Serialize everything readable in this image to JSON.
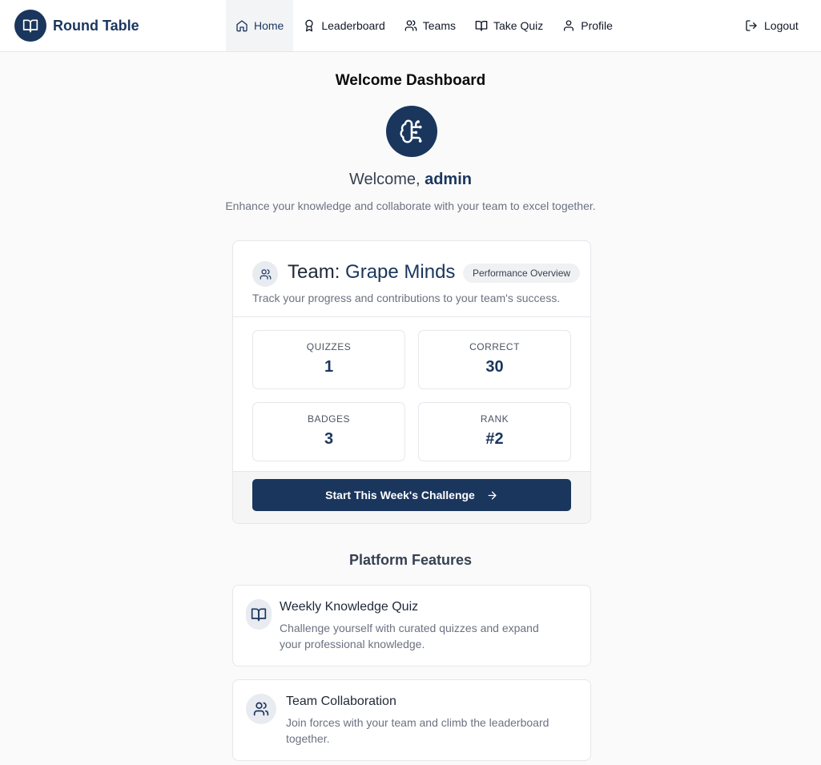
{
  "brand": {
    "name": "Round Table"
  },
  "nav": {
    "items": [
      {
        "label": "Home"
      },
      {
        "label": "Leaderboard"
      },
      {
        "label": "Teams"
      },
      {
        "label": "Take Quiz"
      },
      {
        "label": "Profile"
      }
    ],
    "active": "Home",
    "logout": "Logout"
  },
  "page": {
    "title": "Welcome Dashboard",
    "welcome_prefix": "Welcome,",
    "username": "admin",
    "tagline": "Enhance your knowledge and collaborate with your team to excel together."
  },
  "team": {
    "title_prefix": "Team:",
    "name": "Grape Minds",
    "badge": "Performance Overview",
    "subtitle": "Track your progress and contributions to your team's success.",
    "stats": [
      {
        "label": "QUIZZES",
        "value": "1"
      },
      {
        "label": "CORRECT",
        "value": "30"
      },
      {
        "label": "BADGES",
        "value": "3"
      },
      {
        "label": "RANK",
        "value": "#2"
      }
    ],
    "cta": "Start This Week's Challenge"
  },
  "features": {
    "title": "Platform Features",
    "items": [
      {
        "title": "Weekly Knowledge Quiz",
        "desc": "Challenge yourself with curated quizzes and expand your professional knowledge.",
        "icon": "book-open-icon"
      },
      {
        "title": "Team Collaboration",
        "desc": "Join forces with your team and climb the leaderboard together.",
        "icon": "users-icon"
      }
    ]
  },
  "colors": {
    "primary": "#1a365d",
    "background": "#fafafa"
  }
}
